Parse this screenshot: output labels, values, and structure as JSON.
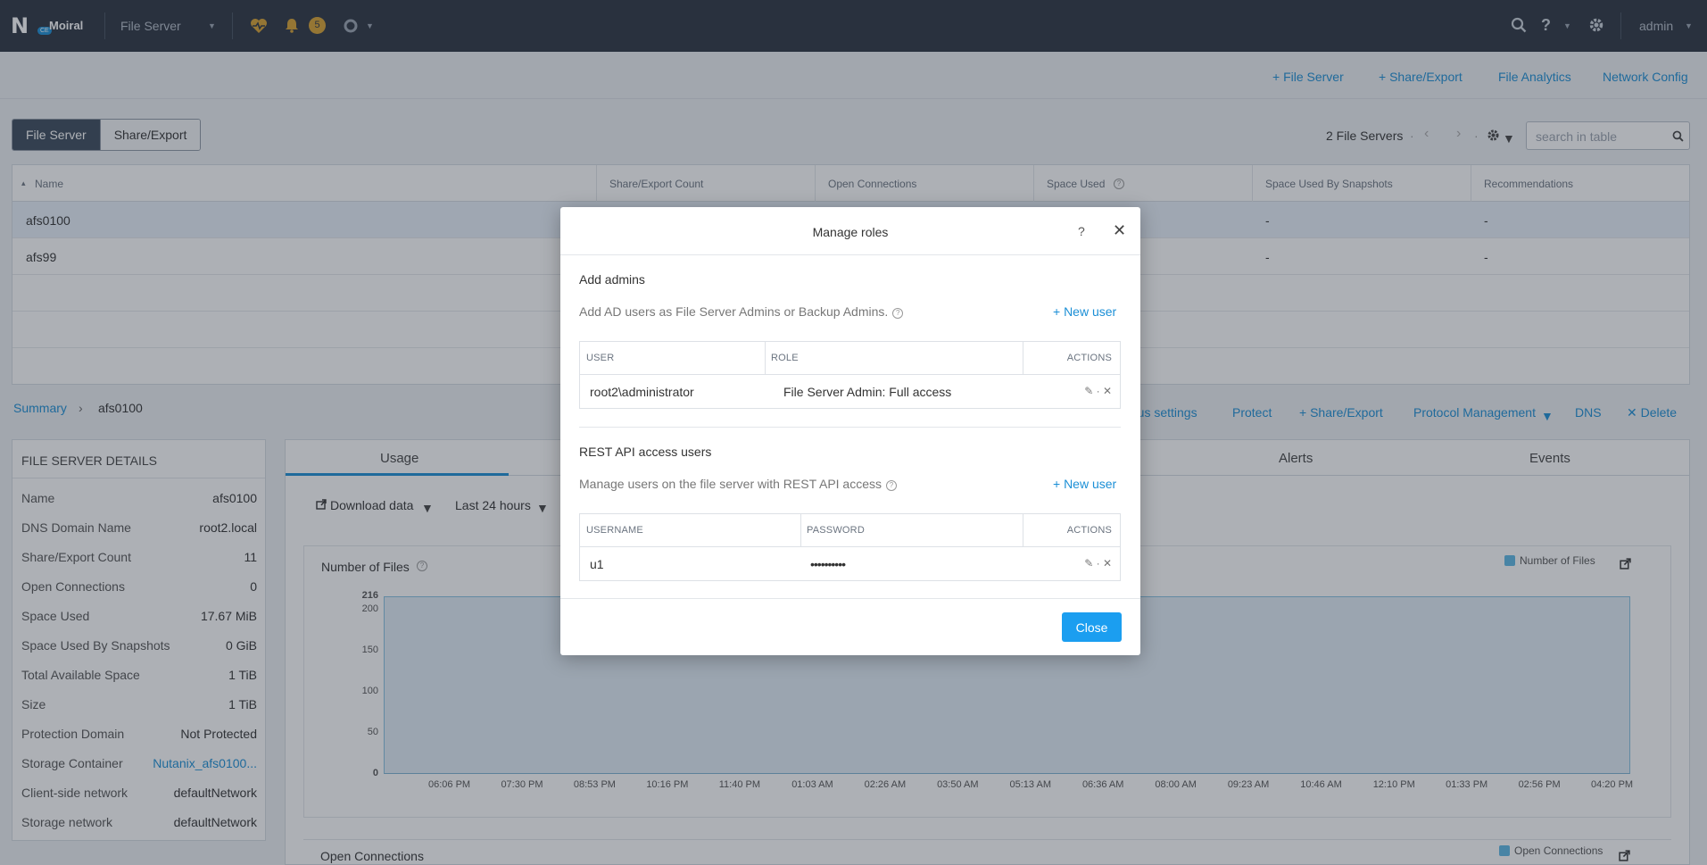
{
  "topnav": {
    "brand": "Moiral",
    "logo_letter": "N",
    "logo_badge": "CE",
    "context_label": "File Server",
    "alert_count": "5",
    "user": "admin"
  },
  "subnav": {
    "add_file_server": "+ File Server",
    "add_share": "+ Share/Export",
    "file_analytics": "File Analytics",
    "network_config": "Network Config"
  },
  "view_toggle": {
    "file_server": "File Server",
    "share_export": "Share/Export"
  },
  "table_toolbar": {
    "count_text": "2 File Servers",
    "dot": "·",
    "search_placeholder": "search in table"
  },
  "file_table": {
    "sort_marker": "▴",
    "columns": [
      "Name",
      "Share/Export Count",
      "Open Connections",
      "Space Used",
      "Space Used By Snapshots",
      "Recommendations"
    ],
    "rows": [
      {
        "name": "afs0100",
        "snapshots": "-",
        "recommendations": "-"
      },
      {
        "name": "afs99",
        "snapshots": "-",
        "recommendations": "-"
      }
    ]
  },
  "breadcrumb": {
    "root": "Summary",
    "sep": "›",
    "current": "afs0100"
  },
  "actions": {
    "virus_settings": "rus settings",
    "protect": "Protect",
    "share_export": "+ Share/Export",
    "protocol": "Protocol Management",
    "dns": "DNS",
    "delete": "✕ Delete"
  },
  "details": {
    "title": "FILE SERVER DETAILS",
    "rows": [
      {
        "k": "Name",
        "v": "afs0100"
      },
      {
        "k": "DNS Domain Name",
        "v": "root2.local"
      },
      {
        "k": "Share/Export Count",
        "v": "11"
      },
      {
        "k": "Open Connections",
        "v": "0"
      },
      {
        "k": "Space Used",
        "v": "17.67 MiB"
      },
      {
        "k": "Space Used By Snapshots",
        "v": "0 GiB"
      },
      {
        "k": "Total Available Space",
        "v": "1 TiB"
      },
      {
        "k": "Size",
        "v": "1 TiB"
      },
      {
        "k": "Protection Domain",
        "v": "Not Protected"
      },
      {
        "k": "Storage Container",
        "v": "Nutanix_afs0100..."
      },
      {
        "k": "Client-side network",
        "v": "defaultNetwork"
      },
      {
        "k": "Storage network",
        "v": "defaultNetwork"
      }
    ]
  },
  "tabs": {
    "usage": "Usage",
    "alerts": "Alerts",
    "events": "Events"
  },
  "controls": {
    "download": "Download data",
    "range": "Last 24 hours"
  },
  "chart": {
    "title": "Number of Files",
    "legend": "Number of Files",
    "second_title": "Open Connections",
    "second_legend": "Open Connections",
    "color": "#5cb8e6"
  },
  "chart_data": {
    "type": "area",
    "title": "Number of Files",
    "xlabel": "",
    "ylabel": "",
    "x": [
      "06:06 PM",
      "07:30 PM",
      "08:53 PM",
      "10:16 PM",
      "11:40 PM",
      "01:03 AM",
      "02:26 AM",
      "03:50 AM",
      "05:13 AM",
      "06:36 AM",
      "08:00 AM",
      "09:23 AM",
      "10:46 AM",
      "12:10 PM",
      "01:33 PM",
      "02:56 PM",
      "04:20 PM"
    ],
    "series": [
      {
        "name": "Number of Files",
        "values": [
          216,
          216,
          216,
          216,
          216,
          216,
          216,
          216,
          216,
          216,
          216,
          216,
          216,
          216,
          216,
          216,
          216
        ]
      }
    ],
    "yticks": [
      "216",
      "200",
      "150",
      "100",
      "50",
      "0"
    ],
    "ylim": [
      0,
      216
    ],
    "grid": false,
    "legend": "top-right"
  },
  "modal": {
    "title": "Manage roles",
    "help": "?",
    "close_icon": "✕",
    "admins": {
      "title": "Add admins",
      "desc": "Add AD users as File Server Admins or Backup Admins.",
      "new_user": "+ New user",
      "columns": [
        "USER",
        "ROLE",
        "ACTIONS"
      ],
      "rows": [
        {
          "user": "root2\\administrator",
          "role": "File Server Admin: Full access"
        }
      ]
    },
    "rest": {
      "title": "REST API access users",
      "desc": "Manage users on the file server with REST API access",
      "new_user": "+ New user",
      "columns": [
        "USERNAME",
        "PASSWORD",
        "ACTIONS"
      ],
      "rows": [
        {
          "user": "u1",
          "password": "••••••••••"
        }
      ]
    },
    "row_actions": "✎ · ✕",
    "close_button": "Close"
  }
}
